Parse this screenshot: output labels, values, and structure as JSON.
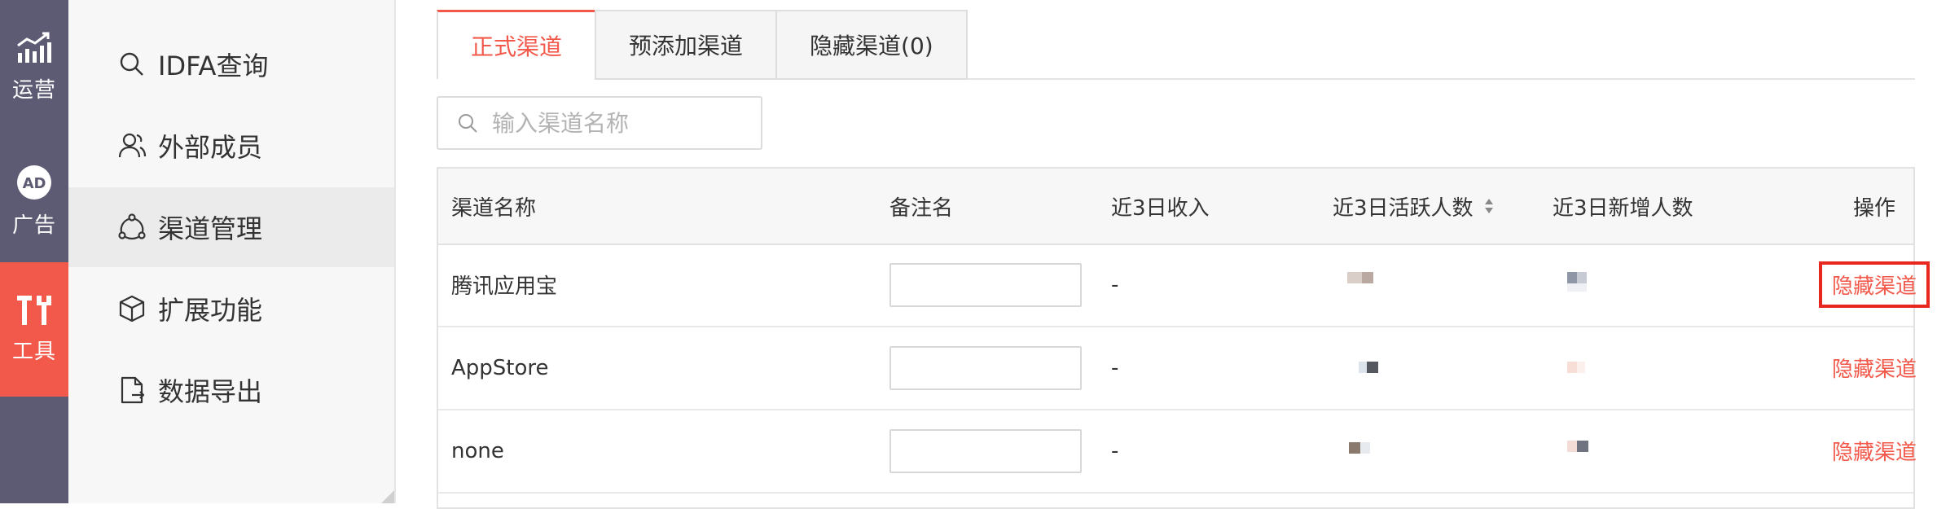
{
  "rail": {
    "items": [
      {
        "label": "运营",
        "icon": "chart-bars-icon"
      },
      {
        "label": "广告",
        "icon": "ad-badge-icon"
      },
      {
        "label": "工具",
        "icon": "tools-icon",
        "active": true
      }
    ]
  },
  "submenu": {
    "items": [
      {
        "label": "IDFA查询",
        "icon": "search-icon"
      },
      {
        "label": "外部成员",
        "icon": "users-icon"
      },
      {
        "label": "渠道管理",
        "icon": "channel-icon",
        "active": true
      },
      {
        "label": "扩展功能",
        "icon": "cube-icon"
      },
      {
        "label": "数据导出",
        "icon": "export-file-icon"
      }
    ]
  },
  "tabs": [
    {
      "label": "正式渠道",
      "active": true
    },
    {
      "label": "预添加渠道"
    },
    {
      "label": "隐藏渠道(0)"
    }
  ],
  "search": {
    "placeholder": "输入渠道名称",
    "value": ""
  },
  "table": {
    "headers": [
      "渠道名称",
      "备注名",
      "近3日收入",
      "近3日活跃人数",
      "近3日新增人数",
      "操作"
    ],
    "rows": [
      {
        "name": "腾讯应用宝",
        "note": "",
        "revenue": "-",
        "action": "隐藏渠道"
      },
      {
        "name": "AppStore",
        "note": "",
        "revenue": "-",
        "action": "隐藏渠道"
      },
      {
        "name": "none",
        "note": "",
        "revenue": "-",
        "action": "隐藏渠道"
      }
    ]
  },
  "colors": {
    "accent": "#f2594b",
    "rail": "#5d5b73",
    "highlight_box": "#e8271f"
  }
}
